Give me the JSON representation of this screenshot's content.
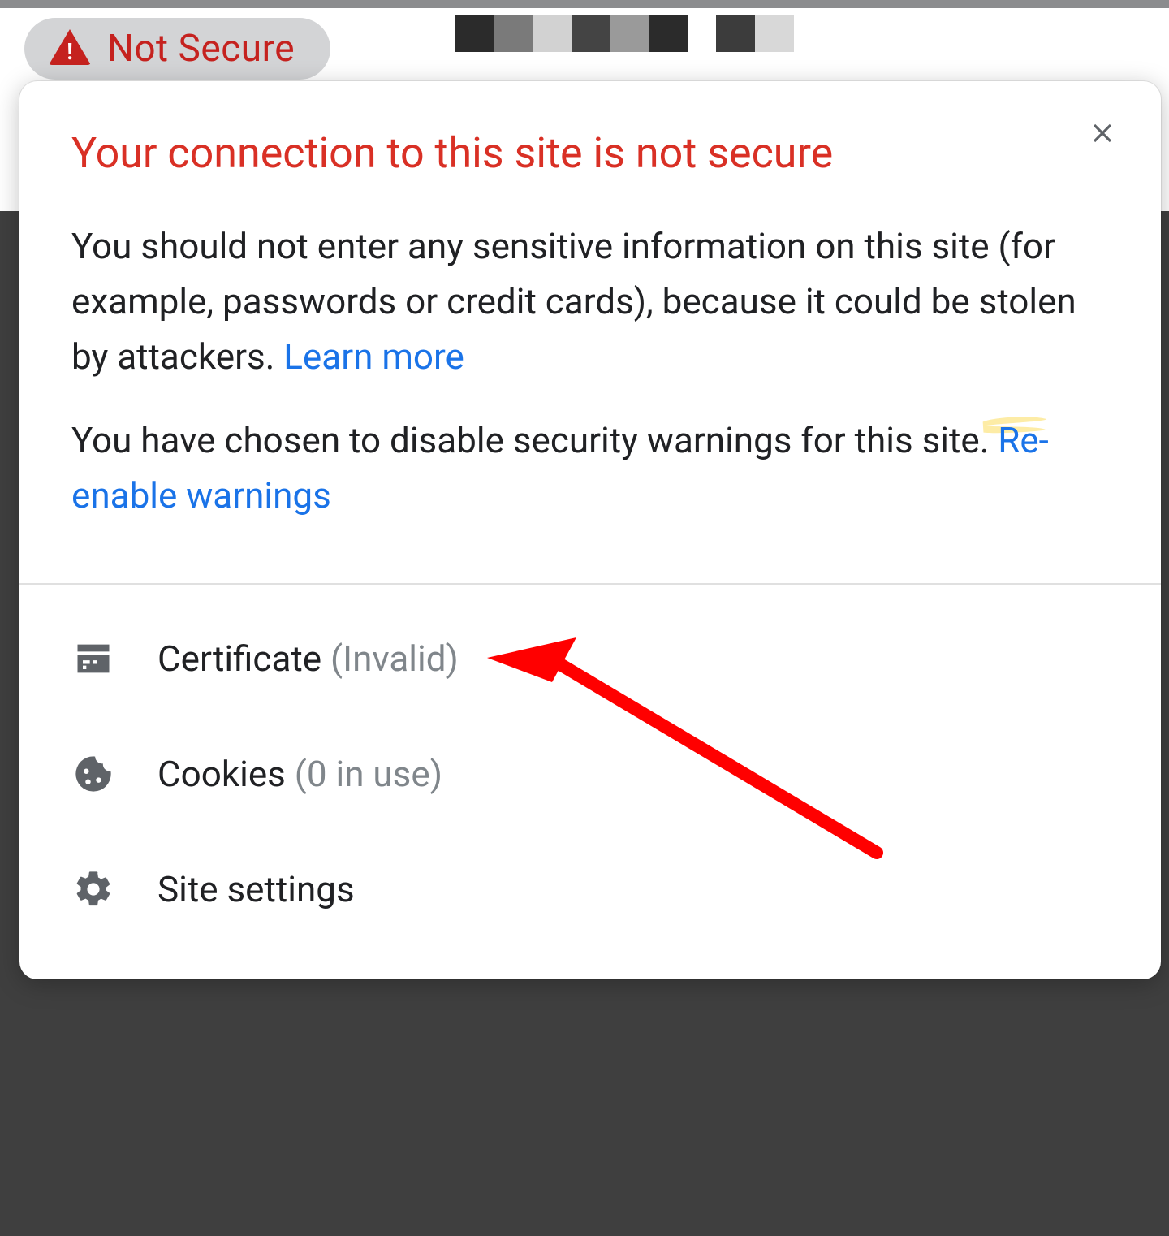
{
  "address_bar": {
    "not_secure_label": "Not Secure"
  },
  "popup": {
    "title": "Your connection to this site is not secure",
    "body1_prefix": "You should not enter any sensitive information on this site (for example, passwords or credit cards), because it could be stolen by attackers. ",
    "body1_link": "Learn more",
    "body2_prefix": "You have chosen to disable security warnings for this site. ",
    "body2_link": "Re-enable warnings",
    "menu": {
      "certificate_label": "Certificate",
      "certificate_status": "(Invalid)",
      "cookies_label": "Cookies",
      "cookies_status": "(0 in use)",
      "site_settings_label": "Site settings"
    }
  }
}
